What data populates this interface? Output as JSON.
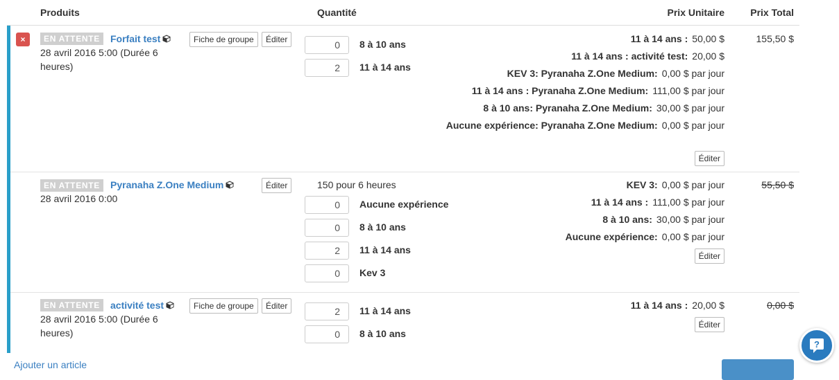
{
  "headers": {
    "produits": "Produits",
    "quantite": "Quantité",
    "prix_unitaire": "Prix Unitaire",
    "prix_total": "Prix Total"
  },
  "colors": {
    "accent": "#2a9fc9",
    "link": "#3a7fc1",
    "danger": "#d9534f",
    "status_bg": "#cfcfcf"
  },
  "items": [
    {
      "delete_symbol": "×",
      "status": "EN ATTENTE",
      "name": "Forfait test",
      "group_btn": "Fiche de groupe",
      "edit_btn": "Éditer",
      "date": "28 avril 2016 5:00 (Durée 6 heures)",
      "quantities": [
        {
          "value": "0",
          "label": "8 à 10 ans"
        },
        {
          "value": "2",
          "label": "11 à 14 ans"
        }
      ],
      "prices": [
        {
          "label": "11 à 14 ans :",
          "value": "50,00 $"
        },
        {
          "label": "11 à 14 ans : activité test:",
          "value": "20,00 $"
        },
        {
          "label": "KEV 3: Pyranaha Z.One Medium:",
          "value": "0,00 $ par jour"
        },
        {
          "label": "11 à 14 ans : Pyranaha Z.One Medium:",
          "value": "111,00 $ par jour"
        },
        {
          "label": "8 à 10 ans: Pyranaha Z.One Medium:",
          "value": "30,00 $ par jour"
        },
        {
          "label": "Aucune expérience: Pyranaha Z.One Medium:",
          "value": "0,00 $ par jour"
        }
      ],
      "price_edit_btn": "Éditer",
      "total": "155,50 $"
    },
    {
      "status": "EN ATTENTE",
      "name": "Pyranaha Z.One Medium",
      "edit_btn": "Éditer",
      "date": "28 avril 2016 0:00",
      "duration_text": "150 pour 6 heures",
      "quantities": [
        {
          "value": "0",
          "label": "Aucune expérience"
        },
        {
          "value": "0",
          "label": "8 à 10 ans"
        },
        {
          "value": "2",
          "label": "11 à 14 ans"
        },
        {
          "value": "0",
          "label": "Kev 3"
        }
      ],
      "prices": [
        {
          "label": "KEV 3:",
          "value": "0,00 $ par jour"
        },
        {
          "label": "11 à 14 ans :",
          "value": "111,00 $ par jour"
        },
        {
          "label": "8 à 10 ans:",
          "value": "30,00 $ par jour"
        },
        {
          "label": "Aucune expérience:",
          "value": "0,00 $ par jour"
        }
      ],
      "price_edit_btn": "Éditer",
      "total": "55,50 $"
    },
    {
      "status": "EN ATTENTE",
      "name": "activité test",
      "group_btn": "Fiche de groupe",
      "edit_btn": "Éditer",
      "date": "28 avril 2016 5:00 (Durée 6 heures)",
      "quantities": [
        {
          "value": "2",
          "label": "11 à 14 ans"
        },
        {
          "value": "0",
          "label": "8 à 10 ans"
        }
      ],
      "prices": [
        {
          "label": "11 à 14 ans :",
          "value": "20,00 $"
        }
      ],
      "price_edit_btn": "Éditer",
      "total": "0,00 $"
    }
  ],
  "footer": {
    "add_link": "Ajouter un article"
  }
}
